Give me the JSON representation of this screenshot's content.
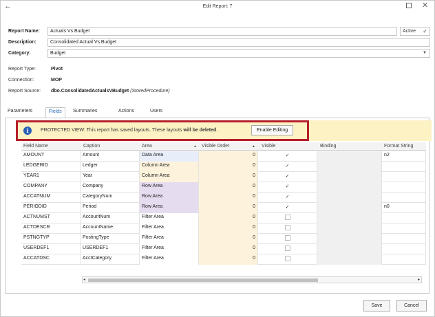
{
  "window": {
    "title": "Edit Report: 7",
    "back_icon": "back-arrow-icon",
    "maximize_icon": "maximize-icon",
    "close_icon": "close-icon"
  },
  "form": {
    "report_name_label": "Report Name:",
    "report_name_value": "Actuals Vs Budget",
    "active_label": "Active",
    "active_checked": true,
    "description_label": "Description:",
    "description_value": "Consolidated Actual Vs Budget",
    "category_label": "Category:",
    "category_value": "Budget",
    "report_type_label": "Report Type:",
    "report_type_value": "Pivot",
    "connection_label": "Connection:",
    "connection_value": "MOP",
    "report_source_label": "Report Source:",
    "report_source_value": "dbo.ConsolidatedActualsVBudget",
    "report_source_type": "(StoredProcedure)"
  },
  "tabs": [
    {
      "label": "Parameters",
      "active": false
    },
    {
      "label": "Fields",
      "active": true
    },
    {
      "label": "Summaries",
      "active": false
    },
    {
      "label": "Actions",
      "active": false
    },
    {
      "label": "Users",
      "active": false
    }
  ],
  "banner": {
    "icon": "info-icon",
    "message_prefix": "PROTECTED VIEW: This report has saved layouts. These layouts ",
    "message_bold": "will be deleted",
    "message_suffix": ".",
    "button_label": "Enable Editing",
    "highlight_color": "#b41f2a"
  },
  "grid": {
    "columns": [
      "Field Name",
      "Caption",
      "Area",
      "Visible Order",
      "Visible",
      "Binding",
      "Format String"
    ],
    "rows": [
      {
        "field": "AMOUNT",
        "caption": "Amount",
        "area": "Data Area",
        "order": "0",
        "visible": true,
        "binding": "",
        "format": "n2"
      },
      {
        "field": "LEDGERID",
        "caption": "Ledger",
        "area": "Column Area",
        "order": "0",
        "visible": true,
        "binding": "",
        "format": ""
      },
      {
        "field": "YEAR1",
        "caption": "Year",
        "area": "Column Area",
        "order": "0",
        "visible": true,
        "binding": "",
        "format": ""
      },
      {
        "field": "COMPANY",
        "caption": "Company",
        "area": "Row Area",
        "order": "0",
        "visible": true,
        "binding": "",
        "format": ""
      },
      {
        "field": "ACCATNUM",
        "caption": "CategoryNum",
        "area": "Row Area",
        "order": "0",
        "visible": true,
        "binding": "",
        "format": ""
      },
      {
        "field": "PERIODID",
        "caption": "Period",
        "area": "Row Area",
        "order": "0",
        "visible": true,
        "binding": "",
        "format": "n0"
      },
      {
        "field": "ACTNUMST",
        "caption": "AccountNum",
        "area": "Filter Area",
        "order": "0",
        "visible": false,
        "binding": "",
        "format": ""
      },
      {
        "field": "ACTDESCR",
        "caption": "AccountName",
        "area": "Filter Area",
        "order": "0",
        "visible": false,
        "binding": "",
        "format": ""
      },
      {
        "field": "PSTNGTYP",
        "caption": "PostingType",
        "area": "Filter Area",
        "order": "0",
        "visible": false,
        "binding": "",
        "format": ""
      },
      {
        "field": "USERDEF1",
        "caption": "USERDEF1",
        "area": "Filter Area",
        "order": "0",
        "visible": false,
        "binding": "",
        "format": ""
      },
      {
        "field": "ACCATDSC",
        "caption": "AcctCategory",
        "area": "Filter Area",
        "order": "0",
        "visible": false,
        "binding": "",
        "format": ""
      }
    ],
    "area_colors": {
      "Data Area": "#e8eef9",
      "Column Area": "#fdf3dc",
      "Row Area": "#e6dcef",
      "Filter Area": "#ffffff"
    },
    "order_bg": "#fdf3dc",
    "binding_bg": "#f0f0f0"
  },
  "footer": {
    "save_label": "Save",
    "cancel_label": "Cancel"
  }
}
